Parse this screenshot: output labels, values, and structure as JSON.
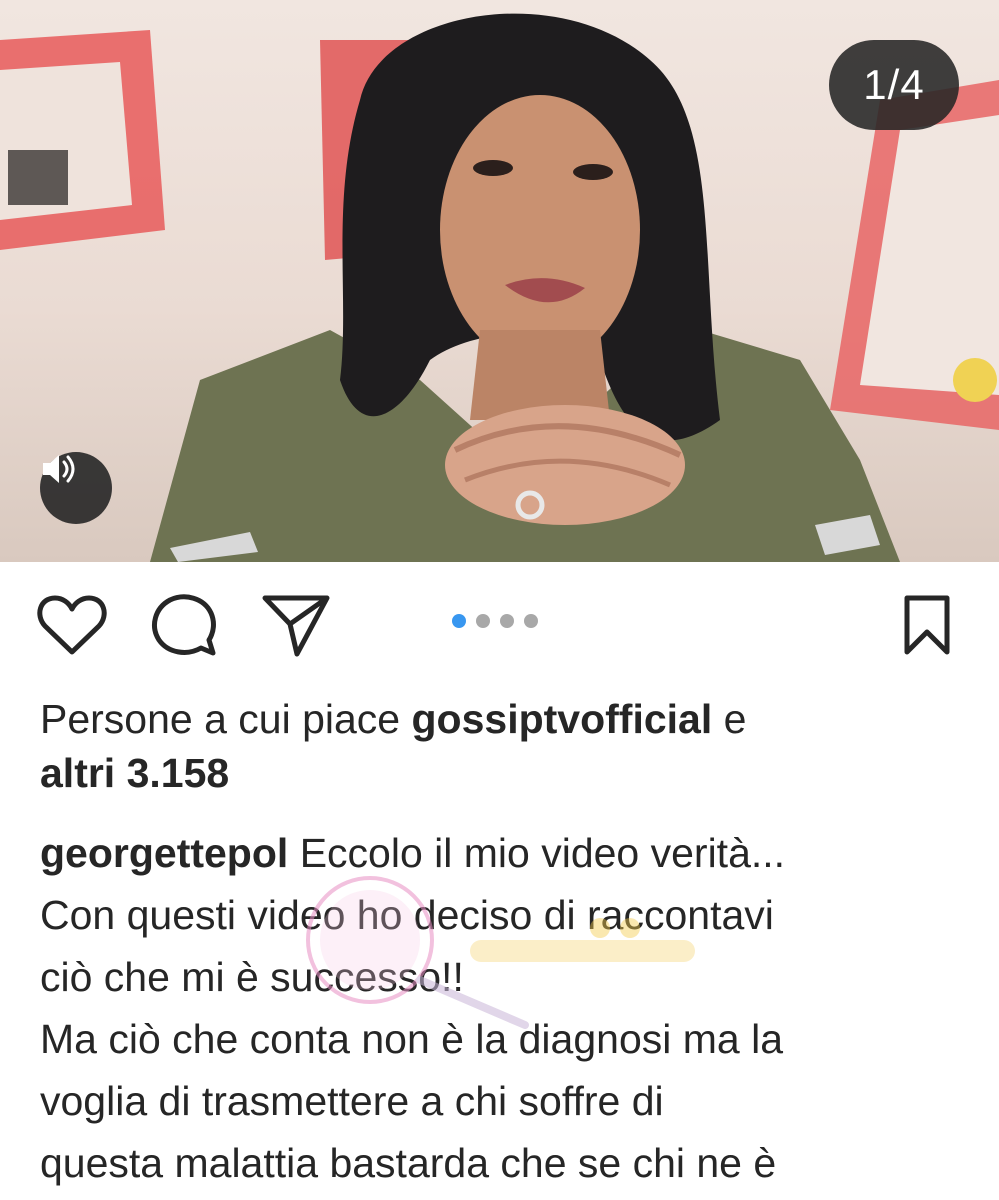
{
  "post": {
    "slide_counter": "1/4",
    "carousel": {
      "total": 4,
      "active_index": 0
    }
  },
  "icons": {
    "like": "heart-icon",
    "comment": "comment-icon",
    "share": "send-icon",
    "save": "bookmark-icon",
    "audio": "speaker-icon"
  },
  "colors": {
    "accent": "#3897f0",
    "text": "#262626",
    "badge_bg": "#262626"
  },
  "likes": {
    "prefix": "Persone a cui piace ",
    "user": "gossiptvofficial",
    "suffix": " e",
    "others": "altri 3.158"
  },
  "caption": {
    "username": "georgettepol",
    "line1": " Eccolo il mio video verità...",
    "line2": "Con questi video ho deciso di raccontavi",
    "line3": "ciò che mi è successo!!",
    "line4": "Ma ciò che conta non è la diagnosi ma la",
    "line5": "voglia di trasmettere a chi soffre di",
    "line6": "questa malattia bastarda che se chi ne è"
  }
}
